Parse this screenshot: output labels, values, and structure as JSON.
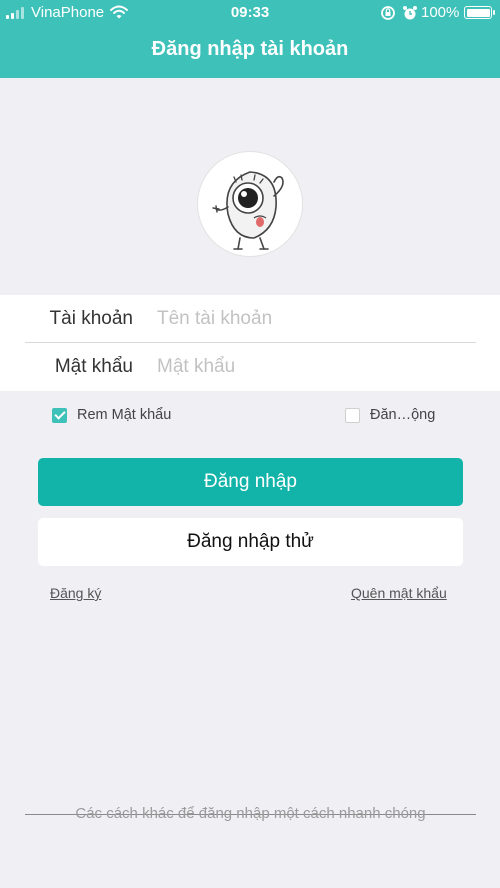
{
  "status_bar": {
    "carrier": "VinaPhone",
    "time": "09:33",
    "battery": "100%",
    "signal_icon": "signal-bars-icon",
    "wifi_icon": "wifi-icon",
    "rotation_icon": "rotation-lock-icon",
    "alarm_icon": "alarm-clock-icon",
    "battery_icon": "battery-icon"
  },
  "header": {
    "title": "Đăng nhập tài khoản",
    "color": "#3ec1b8"
  },
  "avatar": {
    "icon": "eyeball-mascot-icon"
  },
  "form": {
    "account_label": "Tài khoản",
    "account_placeholder": "Tên tài khoản",
    "account_value": "",
    "password_label": "Mật khẩu",
    "password_placeholder": "Mật khẩu",
    "password_value": ""
  },
  "options": {
    "remember_label": "Rem Mật khẩu",
    "remember_checked": true,
    "auto_login_label": "Đăn…ộng",
    "auto_login_checked": false
  },
  "buttons": {
    "login": "Đăng nhập",
    "try_login": "Đăng nhập thử",
    "login_color": "#12b3a9"
  },
  "links": {
    "register": "Đăng ký",
    "forgot_password": "Quên mật khẩu"
  },
  "footer": {
    "other_methods": "Các cách khác để đăng nhập một cách nhanh chóng"
  }
}
